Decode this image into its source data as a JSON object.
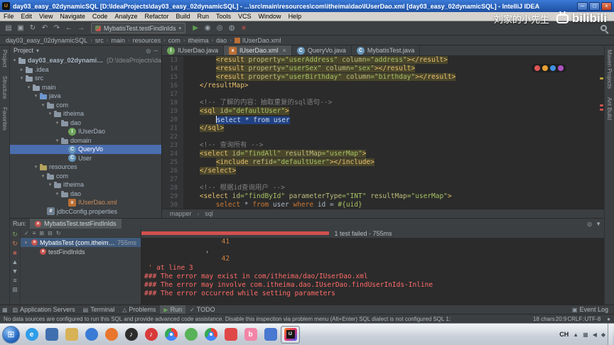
{
  "titlebar": {
    "title": "day03_easy_02dynamicSQL [D:\\IdeaProjects\\day03_easy_02dynamicSQL] - ...\\src\\main\\resources\\com\\itheima\\dao\\IUserDao.xml [day03_easy_02dynamicSQL] - IntelliJ IDEA",
    "app_initials": "IJ"
  },
  "watermark": {
    "text": "刘家的小先生",
    "logo_text": "bilibili"
  },
  "menubar": {
    "items": [
      "File",
      "Edit",
      "View",
      "Navigate",
      "Code",
      "Analyze",
      "Refactor",
      "Build",
      "Run",
      "Tools",
      "VCS",
      "Window",
      "Help"
    ]
  },
  "toolbar": {
    "icons_left": [
      {
        "name": "open-icon",
        "glyph": "▤"
      },
      {
        "name": "save-icon",
        "glyph": "▣"
      },
      {
        "name": "sync-icon",
        "glyph": "↻"
      },
      {
        "name": "undo-icon",
        "glyph": "↶"
      },
      {
        "name": "redo-icon",
        "glyph": "↷"
      },
      {
        "name": "back-icon",
        "glyph": "←"
      },
      {
        "name": "forward-icon",
        "glyph": "→"
      }
    ],
    "run_config": "MybatisTest.testFindInIds",
    "icons_right": [
      {
        "name": "run-icon",
        "glyph": "▶",
        "color": "#5c9e52"
      },
      {
        "name": "debug-icon",
        "glyph": "◉",
        "color": "#9aa5ad"
      },
      {
        "name": "coverage-icon",
        "glyph": "◎",
        "color": "#9aa5ad"
      },
      {
        "name": "profiler-icon",
        "glyph": "◍",
        "color": "#9aa5ad"
      },
      {
        "name": "stop-icon",
        "glyph": "■",
        "color": "#8a4a44"
      }
    ]
  },
  "navbar": {
    "crumbs": [
      "day03_easy_02dynamicSQL",
      "src",
      "main",
      "resources",
      "com",
      "itheima",
      "dao",
      "IUserDao.xml"
    ]
  },
  "left_stripe": {
    "labels": [
      "Project",
      "Structure",
      "Favorites"
    ]
  },
  "right_stripe": {
    "labels": [
      "Maven Projects",
      "Ant Build"
    ]
  },
  "project_panel": {
    "title": "Project",
    "tree": [
      {
        "label": "day03_easy_02dynamicSQL",
        "suffix": " (D:\\IdeaProjects\\da",
        "level": 0,
        "arrow": "v",
        "icon": "project",
        "bold": true
      },
      {
        "label": ".idea",
        "level": 1,
        "arrow": ">",
        "icon": "folder"
      },
      {
        "label": "src",
        "level": 1,
        "arrow": "v",
        "icon": "folder"
      },
      {
        "label": "main",
        "level": 2,
        "arrow": "v",
        "icon": "folder"
      },
      {
        "label": "java",
        "level": 3,
        "arrow": "v",
        "icon": "folder-src"
      },
      {
        "label": "com",
        "level": 4,
        "arrow": "v",
        "icon": "package"
      },
      {
        "label": "itheima",
        "level": 5,
        "arrow": "v",
        "icon": "package"
      },
      {
        "label": "dao",
        "level": 6,
        "arrow": "v",
        "icon": "package"
      },
      {
        "label": "IUserDao",
        "level": 7,
        "icon": "interface"
      },
      {
        "label": "domain",
        "level": 6,
        "arrow": "v",
        "icon": "package"
      },
      {
        "label": "QueryVo",
        "level": 7,
        "icon": "class",
        "selected": true
      },
      {
        "label": "User",
        "level": 7,
        "icon": "class"
      },
      {
        "label": "resources",
        "level": 3,
        "arrow": "v",
        "icon": "folder-res"
      },
      {
        "label": "com",
        "level": 4,
        "arrow": "v",
        "icon": "package"
      },
      {
        "label": "itheima",
        "level": 5,
        "arrow": "v",
        "icon": "package"
      },
      {
        "label": "dao",
        "level": 6,
        "arrow": "v",
        "icon": "package"
      },
      {
        "label": "IUserDao.xml",
        "level": 7,
        "icon": "xml",
        "color": "#cc8c5a"
      },
      {
        "label": "jdbcConfig.properties",
        "level": 4,
        "icon": "properties"
      }
    ]
  },
  "editor": {
    "tabs": [
      {
        "label": "IUserDao.java",
        "icon": "interface"
      },
      {
        "label": "IUserDao.xml",
        "icon": "xml",
        "active": true
      },
      {
        "label": "QueryVo.java",
        "icon": "class"
      },
      {
        "label": "MybatisTest.java",
        "icon": "class"
      }
    ],
    "breadcrumbs": [
      "mapper",
      "sql"
    ],
    "lines": [
      {
        "n": 13,
        "ind": "        ",
        "band": true,
        "seg": [
          [
            "t",
            "<result"
          ],
          [
            "p",
            " "
          ],
          [
            "a",
            "property"
          ],
          [
            "v",
            "=\"userAddress\""
          ],
          [
            "p",
            " "
          ],
          [
            "a",
            "column"
          ],
          [
            "v",
            "=\"address\""
          ],
          [
            "t",
            "></result>"
          ]
        ]
      },
      {
        "n": 14,
        "ind": "        ",
        "band": true,
        "seg": [
          [
            "t",
            "<result"
          ],
          [
            "p",
            " "
          ],
          [
            "a",
            "property"
          ],
          [
            "v",
            "=\"userSex\""
          ],
          [
            "p",
            " "
          ],
          [
            "a",
            "column"
          ],
          [
            "v",
            "=\"sex\""
          ],
          [
            "t",
            "></result>"
          ]
        ]
      },
      {
        "n": 15,
        "ind": "        ",
        "band": true,
        "seg": [
          [
            "t",
            "<result"
          ],
          [
            "p",
            " "
          ],
          [
            "a",
            "property"
          ],
          [
            "v",
            "=\"userBirthday\""
          ],
          [
            "p",
            " "
          ],
          [
            "a",
            "column"
          ],
          [
            "v",
            "=\"birthday\""
          ],
          [
            "t",
            "></result>"
          ]
        ]
      },
      {
        "n": 16,
        "ind": "    ",
        "seg": [
          [
            "t",
            "</resultMap>"
          ]
        ]
      },
      {
        "n": 17,
        "ind": "",
        "seg": []
      },
      {
        "n": 18,
        "ind": "    ",
        "seg": [
          [
            "c",
            "<!-- 了解的内容：抽取重复的sql语句-->"
          ]
        ]
      },
      {
        "n": 19,
        "ind": "    ",
        "band": true,
        "seg": [
          [
            "t",
            "<sql"
          ],
          [
            "p",
            " "
          ],
          [
            "a",
            "id"
          ],
          [
            "v",
            "=\"defaultUser\""
          ],
          [
            "t",
            ">"
          ]
        ]
      },
      {
        "n": 20,
        "ind": "        ",
        "band": true,
        "seg": [
          [
            "caret",
            ""
          ],
          [
            "s",
            "select * from user"
          ]
        ]
      },
      {
        "n": 21,
        "ind": "    ",
        "band": true,
        "seg": [
          [
            "t",
            "</sql>"
          ]
        ]
      },
      {
        "n": 22,
        "ind": "",
        "seg": []
      },
      {
        "n": 23,
        "ind": "    ",
        "seg": [
          [
            "c",
            "<!-- 查询所有 -->"
          ]
        ]
      },
      {
        "n": 24,
        "ind": "    ",
        "band": true,
        "seg": [
          [
            "t",
            "<select"
          ],
          [
            "p",
            " "
          ],
          [
            "a",
            "id"
          ],
          [
            "v",
            "=\"findAll\""
          ],
          [
            "p",
            " "
          ],
          [
            "a",
            "resultMap"
          ],
          [
            "v",
            "=\"userMap\""
          ],
          [
            "t",
            ">"
          ]
        ]
      },
      {
        "n": 25,
        "ind": "        ",
        "band": true,
        "seg": [
          [
            "t",
            "<include"
          ],
          [
            "p",
            " "
          ],
          [
            "a",
            "refid"
          ],
          [
            "v",
            "=\"defaultUser\""
          ],
          [
            "t",
            "></include>"
          ]
        ]
      },
      {
        "n": 26,
        "ind": "    ",
        "band": true,
        "seg": [
          [
            "t",
            "</select>"
          ]
        ]
      },
      {
        "n": 27,
        "ind": "",
        "seg": []
      },
      {
        "n": 28,
        "ind": "    ",
        "seg": [
          [
            "c",
            "<!-- 根据id查询用户 -->"
          ]
        ]
      },
      {
        "n": 29,
        "ind": "    ",
        "seg": [
          [
            "t",
            "<select"
          ],
          [
            "p",
            " "
          ],
          [
            "a",
            "id"
          ],
          [
            "v",
            "=\"findById\""
          ],
          [
            "p",
            " "
          ],
          [
            "a",
            "parameterType"
          ],
          [
            "v",
            "=\"INT\""
          ],
          [
            "p",
            " "
          ],
          [
            "a",
            "resultMap"
          ],
          [
            "v",
            "=\"userMap\""
          ],
          [
            "t",
            ">"
          ]
        ]
      },
      {
        "n": 30,
        "ind": "        ",
        "seg": [
          [
            "k",
            "select"
          ],
          [
            "p",
            " * "
          ],
          [
            "k",
            "from"
          ],
          [
            "p",
            " user "
          ],
          [
            "k",
            "where"
          ],
          [
            "p",
            " id = "
          ],
          [
            "m",
            "#{uid}"
          ]
        ]
      }
    ]
  },
  "floating_dots": [
    "#e05555",
    "#e8a030",
    "#4090e0",
    "#b050c0"
  ],
  "run_panel": {
    "title_prefix": "Run:",
    "tab_label": "MybatisTest.testFindInIds",
    "left_icons": [
      {
        "name": "rerun-icon",
        "glyph": "↻",
        "color": "#76a35c"
      },
      {
        "name": "rerun-failed-icon",
        "glyph": "↻",
        "color": "#c57a52"
      },
      {
        "name": "stop-icon",
        "glyph": "■",
        "color": "#a65a52"
      },
      {
        "name": "previous-test-icon",
        "glyph": "▲",
        "color": "#9aa5ad"
      },
      {
        "name": "next-test-icon",
        "glyph": "▼",
        "color": "#9aa5ad"
      },
      {
        "name": "test-settings-icon",
        "glyph": "≡",
        "color": "#9aa5ad"
      },
      {
        "name": "pin-icon",
        "glyph": "⊞",
        "color": "#9aa5ad"
      }
    ],
    "test_toolbar_icons": [
      {
        "name": "hide-passed-icon",
        "glyph": "✓"
      },
      {
        "name": "sort-icon",
        "glyph": "≡"
      },
      {
        "name": "expand-all-icon",
        "glyph": "⊞"
      },
      {
        "name": "collapse-all-icon",
        "glyph": "⊟"
      },
      {
        "name": "history-icon",
        "glyph": "↻"
      }
    ],
    "progress_label": "1 test failed - 755ms",
    "progress_fraction": 0.41,
    "tests": [
      {
        "label": "MybatisTest (com.itheima.te",
        "time": "755ms",
        "level": 0,
        "selected": true,
        "arrow": "v"
      },
      {
        "label": "testFindInIds",
        "level": 1
      }
    ],
    "console": [
      {
        "text": "                   41",
        "color": "orange"
      },
      {
        "text": "               ,",
        "color": "plain"
      },
      {
        "text": "                   42",
        "color": "orange"
      },
      {
        "text": " ' at line 3",
        "color": "red"
      },
      {
        "text": "### The error may exist in com/itheima/dao/IUserDao.xml",
        "color": "red"
      },
      {
        "text": "### The error may involve com.itheima.dao.IUserDao.findUserInIds-Inline",
        "color": "red"
      },
      {
        "text": "### The error occurred while setting parameters",
        "color": "red"
      }
    ]
  },
  "toolwindow_bar": {
    "left": [
      {
        "label": "Application Servers",
        "icon": "server-icon",
        "glyph": "▥"
      },
      {
        "label": "Terminal",
        "icon": "terminal-icon",
        "glyph": "▤"
      },
      {
        "label": "Problems",
        "icon": "problems-icon",
        "glyph": "△"
      },
      {
        "label": "Run",
        "icon": "run-icon",
        "glyph": "▶",
        "active": true
      },
      {
        "label": "TODO",
        "icon": "todo-icon",
        "glyph": "✓"
      }
    ],
    "right": [
      {
        "label": "Event Log",
        "icon": "event-log-icon",
        "glyph": "▣"
      }
    ]
  },
  "statusbar": {
    "message": "No data sources are configured to run this SQL and provide advanced code assistance. Disable this inspection via problem menu (Alt+Enter)  SQL dialect is not configured  SQL 1:",
    "right_items": [
      "18 chars",
      "20:9",
      "CRLF:",
      "UTF-8"
    ]
  },
  "taskbar": {
    "start_glyph": "⊞",
    "apps": [
      {
        "name": "ie-icon",
        "shape": "circle",
        "bg": "#2f9de8",
        "glyph": "e"
      },
      {
        "name": "browser-app-icon",
        "shape": "square",
        "bg": "#3f6faf",
        "glyph": ""
      },
      {
        "name": "explorer-folder-icon",
        "shape": "square",
        "bg": "#d8b257",
        "glyph": ""
      },
      {
        "name": "blue-circle-app-icon",
        "shape": "circle",
        "bg": "#3a7bd5",
        "glyph": ""
      },
      {
        "name": "firefox-icon",
        "shape": "circle",
        "bg": "#e8762d",
        "glyph": ""
      },
      {
        "name": "music-player-icon",
        "shape": "circle",
        "bg": "#2d2d2d",
        "glyph": "♪"
      },
      {
        "name": "netease-music-icon",
        "shape": "circle",
        "bg": "#d83a3a",
        "glyph": "♪"
      },
      {
        "name": "chrome-icon",
        "shape": "chrome",
        "glyph": ""
      },
      {
        "name": "green-app-icon",
        "shape": "circle",
        "bg": "#58b257",
        "glyph": ""
      },
      {
        "name": "colorful-browser-icon",
        "shape": "chrome",
        "glyph": ""
      },
      {
        "name": "red-app-icon",
        "shape": "square",
        "bg": "#e04848",
        "glyph": ""
      },
      {
        "name": "bilibili-app-icon",
        "shape": "square",
        "bg": "#f285a8",
        "glyph": "b"
      },
      {
        "name": "blue-app-icon",
        "shape": "square",
        "bg": "#4878d0",
        "glyph": ""
      },
      {
        "name": "intellij-idea-icon",
        "shape": "idea",
        "glyph": "",
        "active": true
      }
    ],
    "tray_label": "CH",
    "tray_icons": [
      {
        "name": "tray-arrow-icon",
        "glyph": "▲"
      },
      {
        "name": "tray-network-icon",
        "glyph": "▦"
      },
      {
        "name": "tray-volume-icon",
        "glyph": "◀"
      },
      {
        "name": "tray-shield-icon",
        "glyph": "◆"
      }
    ]
  }
}
